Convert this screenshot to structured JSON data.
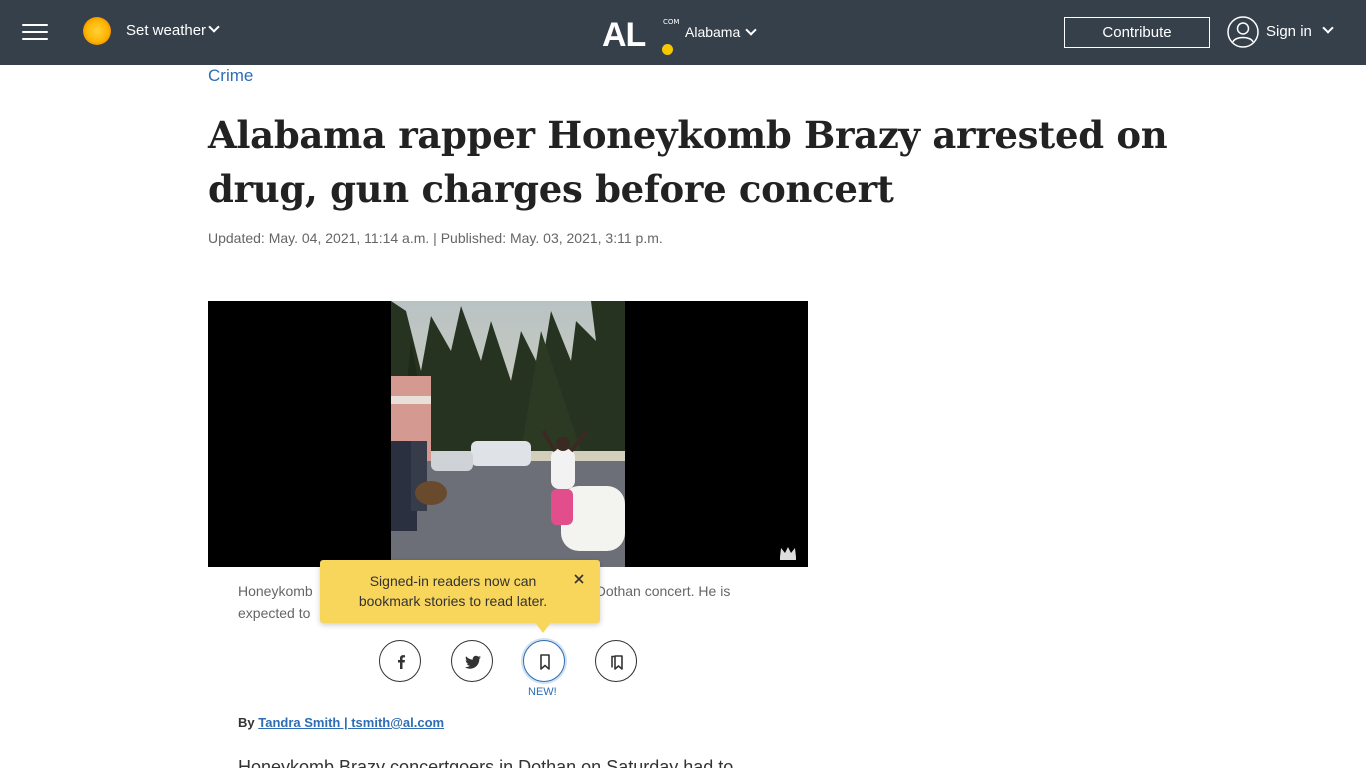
{
  "header": {
    "weather_label": "Set weather",
    "logo_text": "AL",
    "logo_suffix": "COM",
    "region": "Alabama",
    "contribute_label": "Contribute",
    "signin_label": "Sign in",
    "bar_color": "#36404b",
    "logo_dot_color": "#f5c800"
  },
  "article": {
    "section": "Crime",
    "headline": "Alabama rapper Honeykomb Brazy arrested on drug, gun charges before concert",
    "dateline": "Updated: May. 04, 2021, 11:14 a.m. | Published: May. 03, 2021, 3:11 p.m.",
    "caption_start": "Honeykomb",
    "caption_end_1": "Dothan concert. He is",
    "caption_start_2": "expected to",
    "byline_prefix": "By",
    "author": "Tandra Smith | tsmith@al.com",
    "body_first_line": "Honeykomb Brazy concertgoers in Dothan on Saturday had to"
  },
  "tooltip": {
    "text": "Signed-in readers now can bookmark stories to read later.",
    "background": "#f8d55b"
  },
  "share": {
    "buttons": [
      "facebook-icon",
      "twitter-icon",
      "bookmark-icon",
      "saved-bookmarks-icon"
    ],
    "new_label": "NEW!"
  },
  "colors": {
    "link": "#2e6db4"
  }
}
